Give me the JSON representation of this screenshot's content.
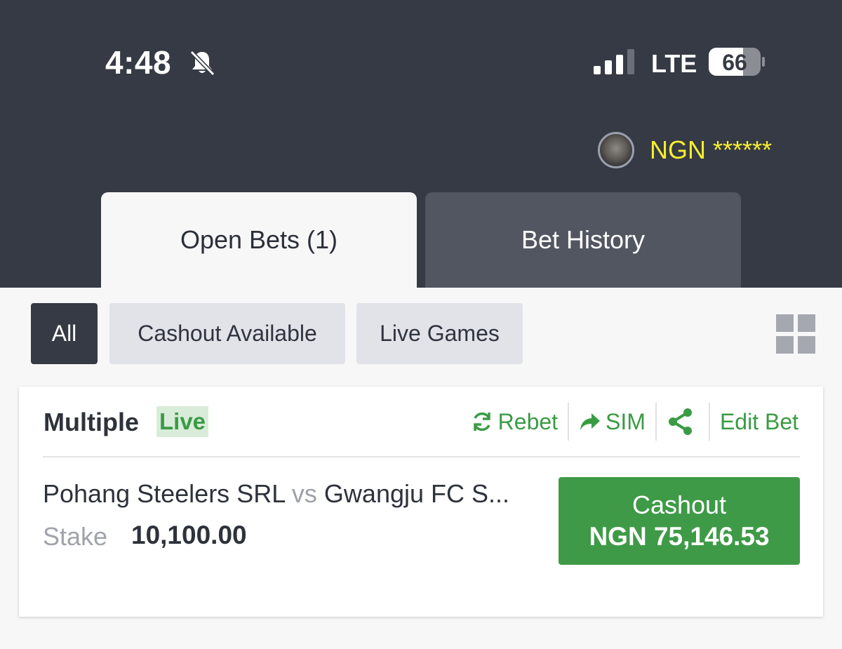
{
  "status_bar": {
    "time": "4:48",
    "network": "LTE",
    "battery_level": "66",
    "icons": [
      "bell-slash-icon",
      "signal-icon",
      "battery-icon"
    ]
  },
  "account": {
    "currency_balance": "NGN ******",
    "balance_color": "#f7ef2b"
  },
  "tabs": [
    {
      "label": "Open Bets (1)",
      "active": true
    },
    {
      "label": "Bet History",
      "active": false
    }
  ],
  "filters": [
    {
      "label": "All",
      "active": true
    },
    {
      "label": "Cashout Available",
      "active": false
    },
    {
      "label": "Live Games",
      "active": false
    }
  ],
  "bet": {
    "type": "Multiple",
    "live_label": "Live",
    "actions": {
      "rebet": "Rebet",
      "sim": "SIM",
      "edit": "Edit Bet"
    },
    "home_team": "Pohang Steelers SRL",
    "vs": "vs",
    "away_team": "Gwangju FC S...",
    "stake_label": "Stake",
    "stake_value": "10,100.00",
    "cashout_label": "Cashout",
    "cashout_amount": "NGN 75,146.53"
  },
  "colors": {
    "header_bg": "#363a45",
    "accent_green": "#3f9a47",
    "active_tab_bg": "#f7f7f8",
    "inactive_tab_bg": "#525661"
  }
}
